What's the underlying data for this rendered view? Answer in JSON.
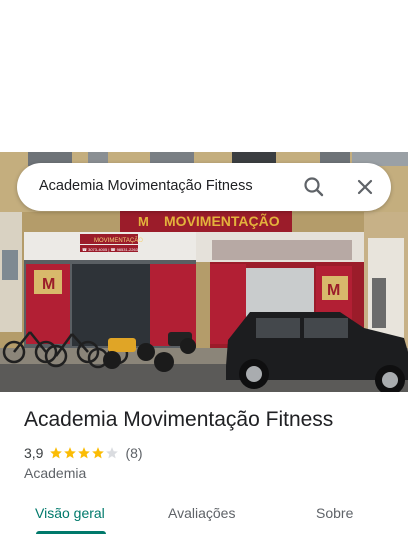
{
  "search": {
    "query": "Academia Movimentação Fitness"
  },
  "icons": {
    "search": "search-icon",
    "close": "close-icon",
    "star": "star-icon"
  },
  "photo": {
    "sign_text": "MOVIMENTAÇÃO",
    "banner_text": "MOVIMENTAÇÃO",
    "phone_text": "☎ 3073-4005 | ☎ 98531-2263",
    "logo_label": "MOVIMENTAÇÃO"
  },
  "place": {
    "name": "Academia Movimentação Fitness",
    "rating": "3,9",
    "rating_value": 3.9,
    "review_count": "(8)",
    "category": "Academia"
  },
  "tabs": [
    {
      "label": "Visão geral",
      "active": true
    },
    {
      "label": "Avaliações",
      "active": false
    },
    {
      "label": "Sobre",
      "active": false
    }
  ],
  "colors": {
    "accent": "#00796b",
    "star": "#fbbc04",
    "star_empty": "#dadce0",
    "sign_red": "#9b1c2a",
    "sign_gold": "#e3b23c"
  }
}
